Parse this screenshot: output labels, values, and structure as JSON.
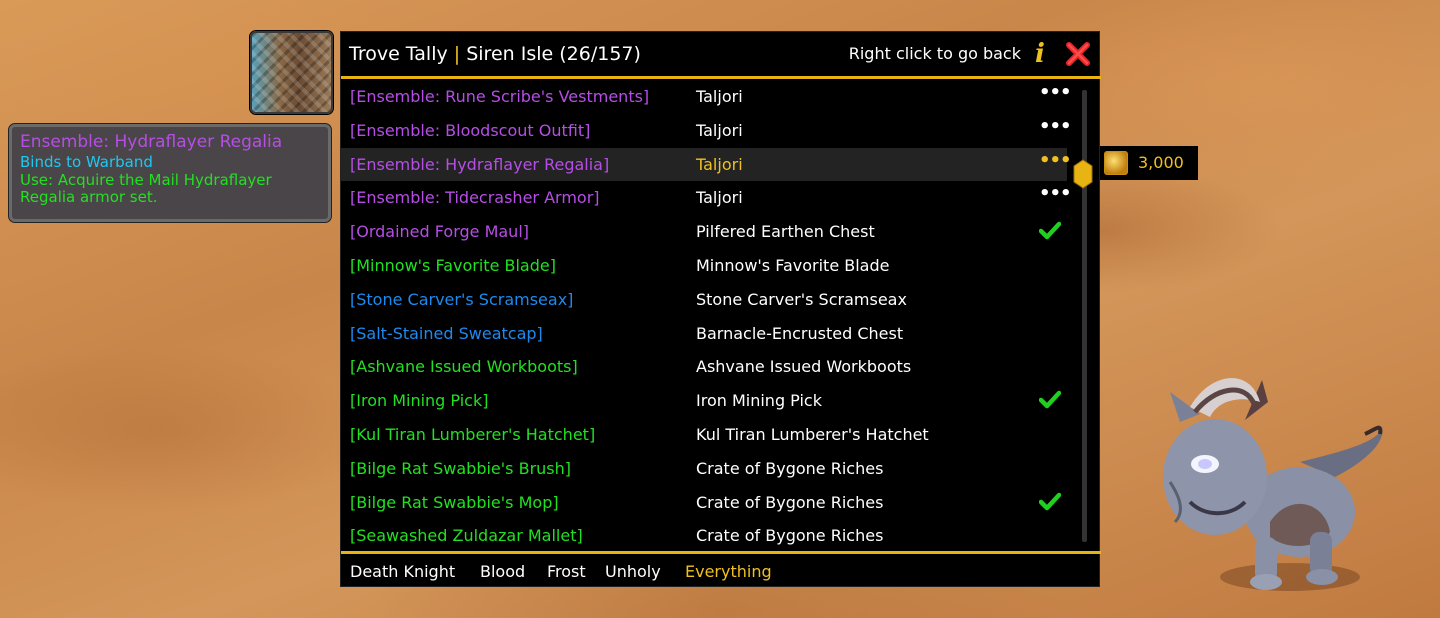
{
  "header": {
    "title": "Trove Tally",
    "separator": "|",
    "subtitle": "Siren Isle (26/157)",
    "hint": "Right click to go back"
  },
  "tooltip": {
    "title": "Ensemble: Hydraflayer Regalia",
    "bind": "Binds to Warband",
    "use_line1": "Use: Acquire the Mail Hydraflayer",
    "use_line2": "Regalia armor set."
  },
  "colors": {
    "epic": "#b64ee6",
    "uncommon": "#22e022",
    "rare": "#1e8af0",
    "accent": "#e8b413"
  },
  "items": [
    {
      "name": "[Ensemble: Rune Scribe's Vestments]",
      "source": "Taljori",
      "quality": "epic",
      "status": "more"
    },
    {
      "name": "[Ensemble: Bloodscout Outfit]",
      "source": "Taljori",
      "quality": "epic",
      "status": "more"
    },
    {
      "name": "[Ensemble: Hydraflayer Regalia]",
      "source": "Taljori",
      "quality": "epic",
      "status": "more",
      "highlight": true
    },
    {
      "name": "[Ensemble: Tidecrasher Armor]",
      "source": "Taljori",
      "quality": "epic",
      "status": "more"
    },
    {
      "name": "[Ordained Forge Maul]",
      "source": "Pilfered Earthen Chest",
      "quality": "epic",
      "status": "collected"
    },
    {
      "name": "[Minnow's Favorite Blade]",
      "source": "Minnow's Favorite Blade",
      "quality": "uncommon",
      "status": ""
    },
    {
      "name": "[Stone Carver's Scramseax]",
      "source": "Stone Carver's Scramseax",
      "quality": "rare",
      "status": ""
    },
    {
      "name": "[Salt-Stained Sweatcap]",
      "source": "Barnacle-Encrusted Chest",
      "quality": "rare",
      "status": ""
    },
    {
      "name": "[Ashvane Issued Workboots]",
      "source": "Ashvane Issued Workboots",
      "quality": "uncommon",
      "status": ""
    },
    {
      "name": "[Iron Mining Pick]",
      "source": "Iron Mining Pick",
      "quality": "uncommon",
      "status": "collected"
    },
    {
      "name": "[Kul Tiran Lumberer's Hatchet]",
      "source": "Kul Tiran Lumberer's Hatchet",
      "quality": "uncommon",
      "status": ""
    },
    {
      "name": "[Bilge Rat Swabbie's Brush]",
      "source": "Crate of Bygone Riches",
      "quality": "uncommon",
      "status": ""
    },
    {
      "name": "[Bilge Rat Swabbie's Mop]",
      "source": "Crate of Bygone Riches",
      "quality": "uncommon",
      "status": "collected"
    },
    {
      "name": "[Seawashed Zuldazar Mallet]",
      "source": "Crate of Bygone Riches",
      "quality": "uncommon",
      "status": ""
    }
  ],
  "footer": {
    "tabs": [
      {
        "label": "Death Knight",
        "active": false
      },
      {
        "label": "Blood",
        "active": false
      },
      {
        "label": "Frost",
        "active": false
      },
      {
        "label": "Unholy",
        "active": false
      },
      {
        "label": "Everything",
        "active": true
      }
    ]
  },
  "cost": {
    "amount": "3,000",
    "icon": "currency-icon"
  },
  "icons": {
    "info": "i",
    "close": "close-icon",
    "more": "•••",
    "collected": "checkmark-icon"
  }
}
